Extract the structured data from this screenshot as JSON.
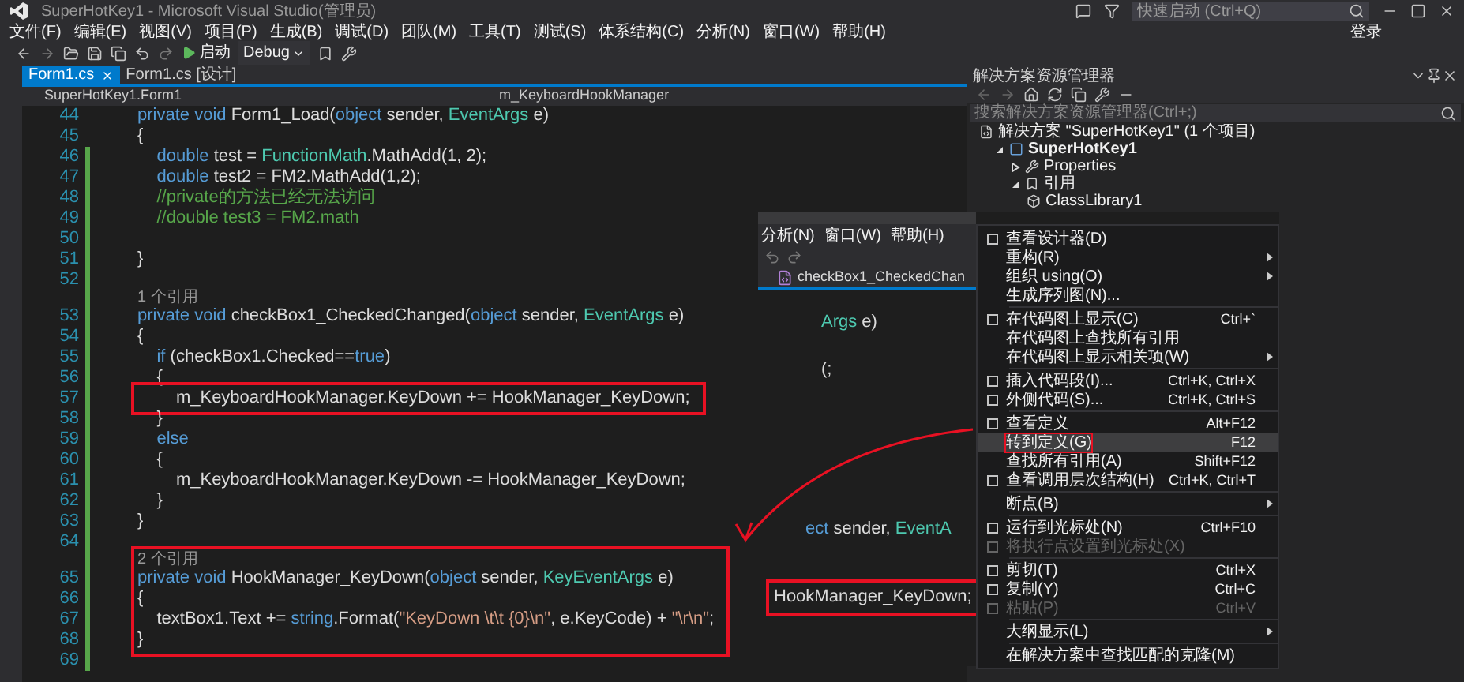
{
  "window": {
    "title": "SuperHotKey1 - Microsoft Visual Studio(管理员)",
    "quick_launch": {
      "placeholder": "快速启动 (Ctrl+Q)"
    },
    "sign_in": "登录"
  },
  "menu": [
    "文件(F)",
    "编辑(E)",
    "视图(V)",
    "项目(P)",
    "生成(B)",
    "调试(D)",
    "团队(M)",
    "工具(T)",
    "测试(S)",
    "体系结构(C)",
    "分析(N)",
    "窗口(W)",
    "帮助(H)"
  ],
  "toolbar": {
    "start": "启动",
    "configuration": "Debug"
  },
  "tabs": [
    {
      "label": "Form1.cs",
      "selected": true
    },
    {
      "label": "Form1.cs [设计]",
      "selected": false
    }
  ],
  "nav_bar": {
    "class": "SuperHotKey1.Form1",
    "member": "m_KeyboardHookManager"
  },
  "code": [
    {
      "number": "44",
      "changed": false,
      "tokens": [
        {
          "kind": "kw",
          "text": "private void "
        },
        {
          "kind": "plain",
          "text": "Form1_Load("
        },
        {
          "kind": "kw",
          "text": "object"
        },
        {
          "kind": "plain",
          "text": " sender, "
        },
        {
          "kind": "type",
          "text": "EventArgs"
        },
        {
          "kind": "plain",
          "text": " e)"
        }
      ]
    },
    {
      "number": "45",
      "changed": false,
      "tokens": [
        {
          "kind": "plain",
          "text": "{"
        }
      ]
    },
    {
      "number": "46",
      "changed": true,
      "tokens": [
        {
          "kind": "kw",
          "text": "    double"
        },
        {
          "kind": "plain",
          "text": " test = "
        },
        {
          "kind": "type",
          "text": "FunctionMath"
        },
        {
          "kind": "plain",
          "text": ".MathAdd(1, 2);"
        }
      ]
    },
    {
      "number": "47",
      "changed": true,
      "tokens": [
        {
          "kind": "kw",
          "text": "    double"
        },
        {
          "kind": "plain",
          "text": " test2 = FM2.MathAdd(1,2);"
        }
      ]
    },
    {
      "number": "48",
      "changed": true,
      "tokens": [
        {
          "kind": "comment",
          "text": "    //private的方法已经无法访问"
        }
      ]
    },
    {
      "number": "49",
      "changed": true,
      "tokens": [
        {
          "kind": "comment",
          "text": "    //double test3 = FM2.math"
        }
      ]
    },
    {
      "number": "50",
      "changed": true
    },
    {
      "number": "51",
      "changed": true,
      "tokens": [
        {
          "kind": "plain",
          "text": "}"
        }
      ]
    },
    {
      "number": "52",
      "changed": true
    },
    {
      "number": "53",
      "changed": true,
      "lens": "1 个引用",
      "tokens": [
        {
          "kind": "kw",
          "text": "private void "
        },
        {
          "kind": "plain",
          "text": "checkBox1_CheckedChanged("
        },
        {
          "kind": "kw",
          "text": "object"
        },
        {
          "kind": "plain",
          "text": " sender, "
        },
        {
          "kind": "type",
          "text": "EventArgs"
        },
        {
          "kind": "plain",
          "text": " e)"
        }
      ]
    },
    {
      "number": "54",
      "changed": true,
      "tokens": [
        {
          "kind": "plain",
          "text": "{"
        }
      ]
    },
    {
      "number": "55",
      "changed": true,
      "tokens": [
        {
          "kind": "kw",
          "text": "    if"
        },
        {
          "kind": "plain",
          "text": " (checkBox1.Checked=="
        },
        {
          "kind": "kw",
          "text": "true"
        },
        {
          "kind": "plain",
          "text": ")"
        }
      ]
    },
    {
      "number": "56",
      "changed": true,
      "tokens": [
        {
          "kind": "plain",
          "text": "    {"
        }
      ]
    },
    {
      "number": "57",
      "changed": true,
      "boxed": true,
      "tokens": [
        {
          "kind": "plain",
          "text": "        m_KeyboardHookManager.KeyDown += HookManager_KeyDown;"
        }
      ]
    },
    {
      "number": "58",
      "changed": true,
      "tokens": [
        {
          "kind": "plain",
          "text": "    }"
        }
      ]
    },
    {
      "number": "59",
      "changed": true,
      "tokens": [
        {
          "kind": "kw",
          "text": "    else"
        }
      ]
    },
    {
      "number": "60",
      "changed": true,
      "tokens": [
        {
          "kind": "plain",
          "text": "    {"
        }
      ]
    },
    {
      "number": "61",
      "changed": true,
      "tokens": [
        {
          "kind": "plain",
          "text": "        m_KeyboardHookManager.KeyDown -= HookManager_KeyDown;"
        }
      ]
    },
    {
      "number": "62",
      "changed": true,
      "tokens": [
        {
          "kind": "plain",
          "text": "    }"
        }
      ]
    },
    {
      "number": "63",
      "changed": true,
      "tokens": [
        {
          "kind": "plain",
          "text": "}"
        }
      ]
    },
    {
      "number": "64",
      "changed": true
    },
    {
      "number": "65",
      "changed": true,
      "boxed": true,
      "lens": "2 个引用",
      "tokens": [
        {
          "kind": "kw",
          "text": "private void "
        },
        {
          "kind": "plain",
          "text": "HookManager_KeyDown("
        },
        {
          "kind": "kw",
          "text": "object"
        },
        {
          "kind": "plain",
          "text": " sender, "
        },
        {
          "kind": "type",
          "text": "KeyEventArgs"
        },
        {
          "kind": "plain",
          "text": " e)"
        }
      ]
    },
    {
      "number": "66",
      "changed": true,
      "boxed": true,
      "tokens": [
        {
          "kind": "plain",
          "text": "{"
        }
      ]
    },
    {
      "number": "67",
      "changed": true,
      "boxed": true,
      "tokens": [
        {
          "kind": "plain",
          "text": "    textBox1.Text += "
        },
        {
          "kind": "kw",
          "text": "string"
        },
        {
          "kind": "plain",
          "text": ".Format("
        },
        {
          "kind": "string",
          "text": "\"KeyDown \\t\\t {0}\\n\""
        },
        {
          "kind": "plain",
          "text": ", e.KeyCode) + "
        },
        {
          "kind": "string",
          "text": "\"\\r\\n\""
        },
        {
          "kind": "plain",
          "text": ";"
        }
      ]
    },
    {
      "number": "68",
      "changed": true,
      "boxed": true,
      "tokens": [
        {
          "kind": "plain",
          "text": "}"
        }
      ]
    },
    {
      "number": "69",
      "changed": true
    }
  ],
  "solution_explorer": {
    "title": "解决方案资源管理器",
    "search": {
      "placeholder": "搜索解决方案资源管理器(Ctrl+;)"
    },
    "tree": [
      {
        "label": "解决方案 \"SuperHotKey1\" (1 个项目)",
        "kind": "solution",
        "children": [
          {
            "label": "SuperHotKey1",
            "kind": "project",
            "expanded": true,
            "children": [
              {
                "label": "Properties",
                "kind": "properties",
                "expanded": false
              },
              {
                "label": "引用",
                "kind": "references",
                "expanded": true,
                "children": [
                  {
                    "label": "ClassLibrary1",
                    "kind": "reference"
                  }
                ]
              }
            ]
          }
        ]
      }
    ]
  },
  "overlay": {
    "menu": [
      "分析(N)",
      "窗口(W)",
      "帮助(H)"
    ],
    "nav_member": "checkBox1_CheckedChan",
    "fragments": [
      {
        "tokens": [
          {
            "kind": "type",
            "text": "Args"
          },
          {
            "kind": "plain",
            "text": " e)"
          }
        ]
      },
      {
        "tokens": [
          {
            "kind": "plain",
            "text": "(;"
          }
        ]
      },
      {
        "tokens": [
          {
            "kind": "kw",
            "text": "ect"
          },
          {
            "kind": "plain",
            "text": " sender, "
          },
          {
            "kind": "type",
            "text": "EventA"
          }
        ]
      },
      {
        "boxed": true,
        "tokens": [
          {
            "kind": "plain",
            "text": "HookManager_KeyDown;"
          }
        ]
      }
    ],
    "context_menu": [
      [
        {
          "label": "查看设计器(D)",
          "icon": true
        },
        {
          "label": "重构(R)",
          "submenu": true
        },
        {
          "label": "组织 using(O)",
          "submenu": true
        },
        {
          "label": "生成序列图(N)..."
        }
      ],
      [
        {
          "label": "在代码图上显示(C)",
          "shortcut": "Ctrl+`",
          "icon": true
        },
        {
          "label": "在代码图上查找所有引用"
        },
        {
          "label": "在代码图上显示相关项(W)",
          "submenu": true
        }
      ],
      [
        {
          "label": "插入代码段(I)...",
          "shortcut": "Ctrl+K, Ctrl+X",
          "icon": true
        },
        {
          "label": "外侧代码(S)...",
          "shortcut": "Ctrl+K, Ctrl+S",
          "icon": true
        }
      ],
      [
        {
          "label": "查看定义",
          "shortcut": "Alt+F12",
          "icon": true
        },
        {
          "label": "转到定义(G)",
          "shortcut": "F12",
          "selected": true,
          "boxed": true
        },
        {
          "label": "查找所有引用(A)",
          "shortcut": "Shift+F12"
        },
        {
          "label": "查看调用层次结构(H)",
          "shortcut": "Ctrl+K, Ctrl+T",
          "icon": true
        }
      ],
      [
        {
          "label": "断点(B)",
          "submenu": true
        }
      ],
      [
        {
          "label": "运行到光标处(N)",
          "shortcut": "Ctrl+F10",
          "icon": true
        },
        {
          "label": "将执行点设置到光标处(X)",
          "disabled": true,
          "icon": true
        }
      ],
      [
        {
          "label": "剪切(T)",
          "shortcut": "Ctrl+X",
          "icon": true
        },
        {
          "label": "复制(Y)",
          "shortcut": "Ctrl+C",
          "icon": true
        },
        {
          "label": "粘贴(P)",
          "shortcut": "Ctrl+V",
          "disabled": true,
          "icon": true
        }
      ],
      [
        {
          "label": "大纲显示(L)",
          "submenu": true
        }
      ],
      [
        {
          "label": "在解决方案中查找匹配的克隆(M)"
        }
      ]
    ]
  }
}
